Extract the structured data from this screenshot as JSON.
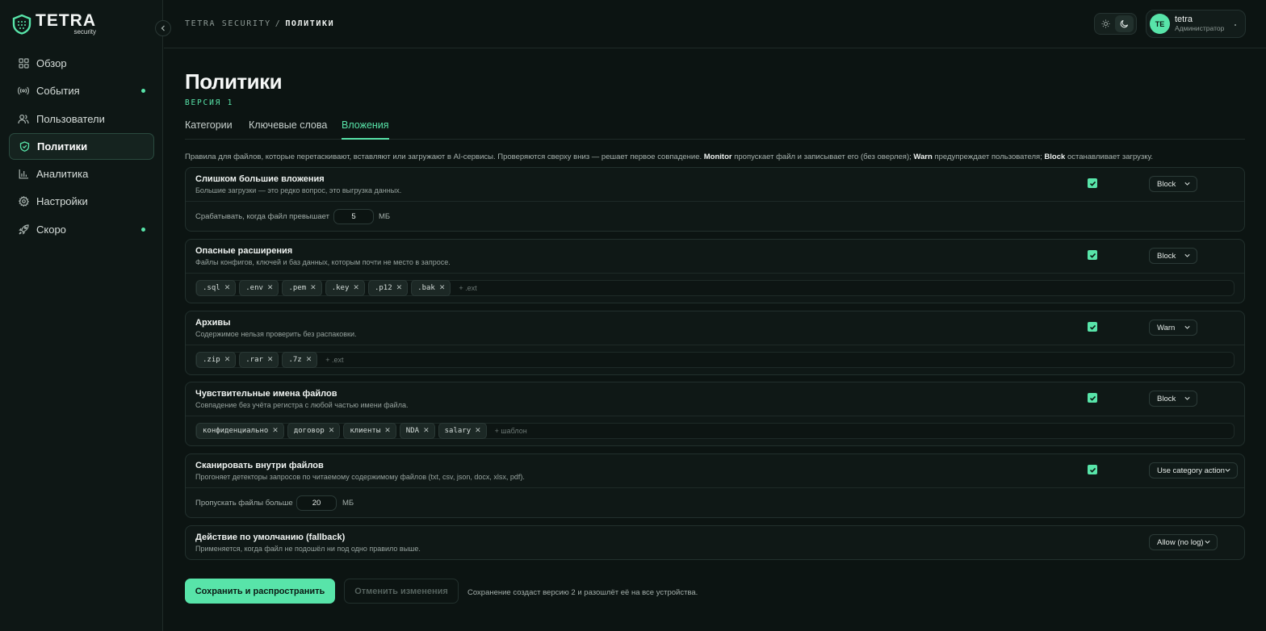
{
  "brand": {
    "word": "TETRA",
    "sub": "security"
  },
  "sidebar": {
    "items": [
      {
        "label": "Обзор",
        "icon": "grid-icon",
        "dot": false,
        "active": false
      },
      {
        "label": "События",
        "icon": "broadcast-icon",
        "dot": true,
        "active": false
      },
      {
        "label": "Пользователи",
        "icon": "users-icon",
        "dot": false,
        "active": false
      },
      {
        "label": "Политики",
        "icon": "shield-icon",
        "dot": false,
        "active": true
      },
      {
        "label": "Аналитика",
        "icon": "bar-chart-icon",
        "dot": false,
        "active": false
      },
      {
        "label": "Настройки",
        "icon": "gear-icon",
        "dot": false,
        "active": false
      },
      {
        "label": "Скоро",
        "icon": "rocket-icon",
        "dot": true,
        "active": false
      }
    ],
    "collapse_icon": "chevron-left-icon"
  },
  "header": {
    "crumb_root": "TETRA SECURITY",
    "crumb_sep": "/",
    "crumb_current": "ПОЛИТИКИ",
    "user": {
      "initials": "TE",
      "name": "tetra",
      "role": "Администратор"
    }
  },
  "page": {
    "title": "Политики",
    "version": "ВЕРСИЯ 1",
    "tabs": [
      "Категории",
      "Ключевые слова",
      "Вложения"
    ],
    "active_tab": 2,
    "intro_a": "Правила для файлов, которые перетаскивают, вставляют или загружают в AI-сервисы. Проверяются сверху вниз — решает первое совпадение.",
    "intro_monitor": "Monitor",
    "intro_b": "пропускает файл и записывает его (без оверлея);",
    "intro_warn": "Warn",
    "intro_c": "предупреждает пользователя;",
    "intro_block": "Block",
    "intro_d": "останавливает загрузку."
  },
  "rules": {
    "large": {
      "title": "Слишком большие вложения",
      "desc": "Большие загрузки — это редко вопрос, это выгрузка данных.",
      "enabled": true,
      "action": "Block",
      "label": "Срабатывать, когда файл превышает",
      "value": "5",
      "unit": "МБ"
    },
    "ext": {
      "title": "Опасные расширения",
      "desc": "Файлы конфигов, ключей и баз данных, которым почти не место в запросе.",
      "enabled": true,
      "action": "Block",
      "tags": [
        ".sql",
        ".env",
        ".pem",
        ".key",
        ".p12",
        ".bak"
      ],
      "placeholder": "+ .ext"
    },
    "archives": {
      "title": "Архивы",
      "desc": "Содержимое нельзя проверить без распаковки.",
      "enabled": true,
      "action": "Warn",
      "tags": [
        ".zip",
        ".rar",
        ".7z"
      ],
      "placeholder": "+ .ext"
    },
    "names": {
      "title": "Чувствительные имена файлов",
      "desc": "Совпадение без учёта регистра с любой частью имени файла.",
      "enabled": true,
      "action": "Block",
      "tags": [
        "конфиденциально",
        "договор",
        "клиенты",
        "NDA",
        "salary"
      ],
      "placeholder": "+ шаблон"
    },
    "scan": {
      "title": "Сканировать внутри файлов",
      "desc": "Прогоняет детекторы запросов по читаемому содержимому файлов (txt, csv, json, docx, xlsx, pdf).",
      "enabled": true,
      "action": "Use category action",
      "label": "Пропускать файлы больше",
      "value": "20",
      "unit": "МБ"
    },
    "fallback": {
      "title": "Действие по умолчанию (fallback)",
      "desc": "Применяется, когда файл не подошёл ни под одно правило выше.",
      "action": "Allow (no log)"
    }
  },
  "footer": {
    "save": "Сохранить и распространить",
    "cancel": "Отменить изменения",
    "note": "Сохранение создаст версию 2 и разошлёт её на все устройства."
  },
  "colors": {
    "accent": "#58e4a9",
    "background": "#0c1412",
    "sidebar": "#0e1715"
  }
}
